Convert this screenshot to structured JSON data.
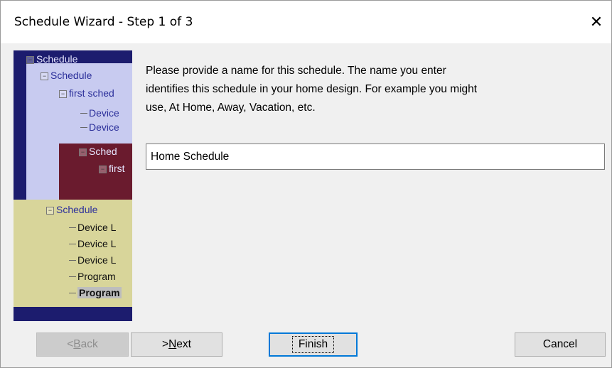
{
  "window": {
    "title": "Schedule Wizard - Step 1 of 3",
    "close_glyph": "✕"
  },
  "sidebar": {
    "tree": [
      {
        "label": "Schedule"
      },
      {
        "label": "Schedule"
      },
      {
        "label": "first sched"
      },
      {
        "label": "Device"
      },
      {
        "label": "Device"
      },
      {
        "label": "Sched"
      },
      {
        "label": "first"
      },
      {
        "label": "Schedule"
      },
      {
        "label": "Device L"
      },
      {
        "label": "Device L"
      },
      {
        "label": "Device L"
      },
      {
        "label": "Program"
      },
      {
        "label": "Program"
      }
    ]
  },
  "main": {
    "description_line1": "Please provide a name for this schedule.  The name you enter",
    "description_line2": "identifies this schedule in your home design.  For example you might",
    "description_line3": "use, At Home, Away, Vacation, etc.",
    "name_value": "Home Schedule"
  },
  "buttons": {
    "back_prefix": "< ",
    "back_key": "B",
    "back_rest": "ack",
    "next_prefix": "> ",
    "next_key": "N",
    "next_rest": "ext",
    "finish": "Finish",
    "cancel": "Cancel"
  }
}
